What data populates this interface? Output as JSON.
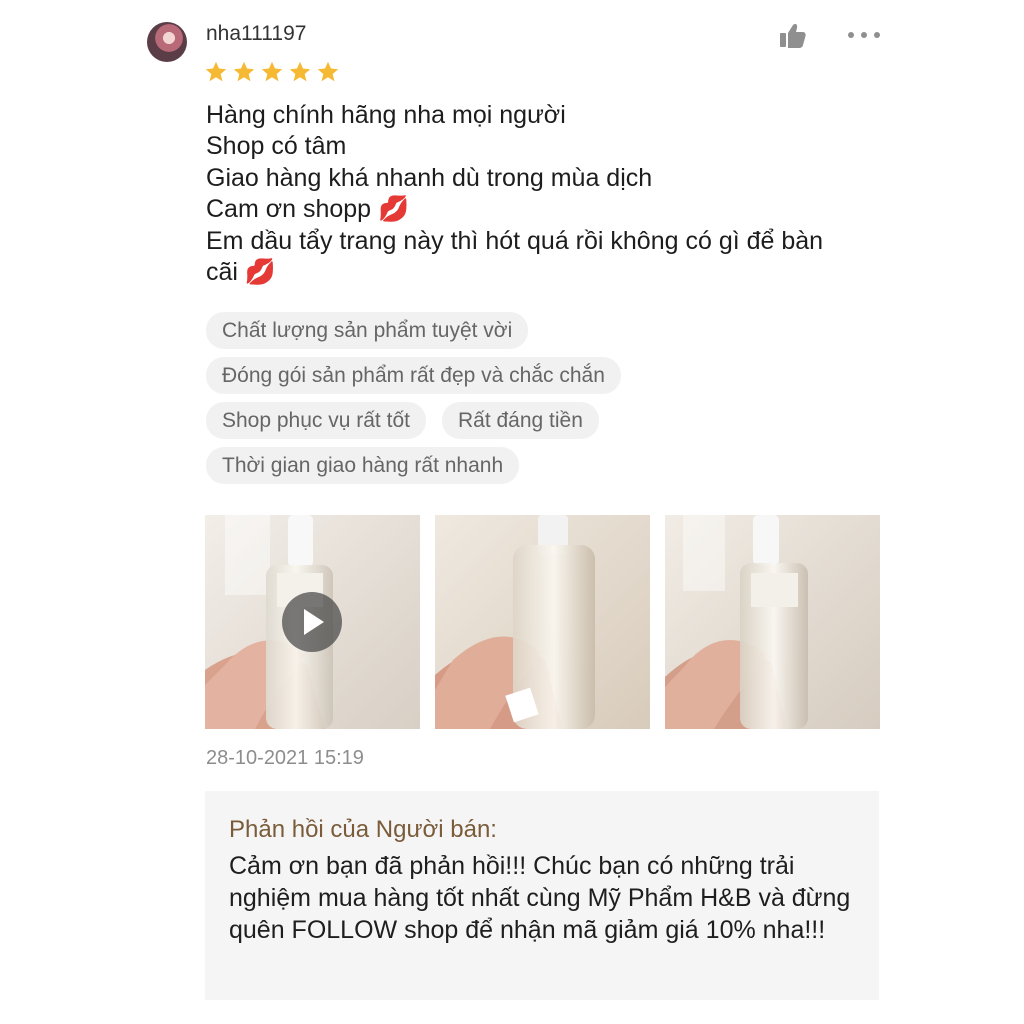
{
  "review": {
    "username": "nha111197",
    "rating": 5,
    "lines": [
      "Hàng chính hãng nha mọi người",
      "Shop có tâm",
      "Giao hàng khá nhanh dù trong mùa dịch",
      "Cam ơn shopp 💋",
      "Em dầu tẩy trang này thì hót quá rồi không có gì để bàn",
      "cãi 💋"
    ],
    "tags": [
      "Chất lượng sản phẩm tuyệt vời",
      "Đóng gói sản phẩm rất đẹp và chắc chắn",
      "Shop phục vụ rất tốt",
      "Rất đáng tiền",
      "Thời gian giao hàng rất nhanh"
    ],
    "timestamp": "28-10-2021 15:19"
  },
  "icons": {
    "like": "thumbs-up-icon",
    "more": "more-icon",
    "star": "star-icon",
    "play": "play-icon"
  },
  "colors": {
    "star": "#f6b933",
    "tag_bg": "#f1f1f1",
    "tag_text": "#666666",
    "reply_title": "#7a5c3a"
  },
  "seller_reply": {
    "title": "Phản hồi của Người bán:",
    "text": "Cảm ơn bạn đã phản hồi!!! Chúc bạn có những trải nghiệm mua hàng tốt nhất cùng Mỹ Phẩm H&B và đừng quên FOLLOW shop để nhận mã giảm giá 10% nha!!!"
  }
}
